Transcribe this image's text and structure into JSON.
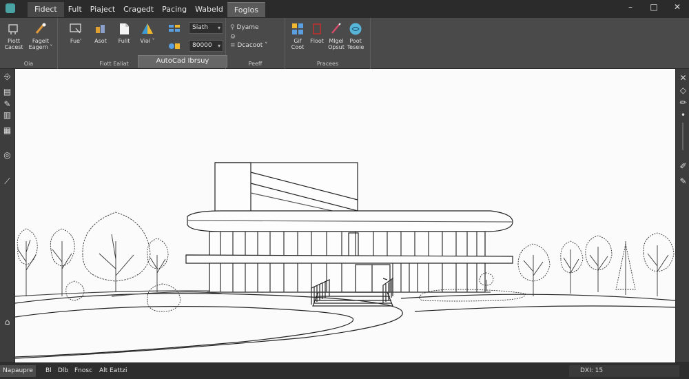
{
  "menu": {
    "tabs": [
      "Fidect",
      "Fult",
      "Piaject",
      "Cragedt",
      "Pacing",
      "Wabeld",
      "Foglos"
    ]
  },
  "window": {
    "minimize": "–",
    "maximize": "□",
    "close": "✕"
  },
  "ribbon": {
    "group1": {
      "tools": [
        "Piott\nCacest",
        "Fagelt\nEagern ˅"
      ],
      "label": "Oia"
    },
    "group2": {
      "tools": [
        "Fue'",
        "Asot",
        "Fulit",
        "Viəl ˅"
      ],
      "combo1": "Siath",
      "combo2": "80000",
      "label": "Fiott Ealiat"
    },
    "group3": {
      "items": [
        "Dyame",
        "Dcacoot ˅"
      ],
      "label": "Peeff"
    },
    "group4": {
      "tools": [
        "Gif\nCoot",
        "Floot",
        "Mlgel\nOpsut",
        "Poot\nTeseie"
      ],
      "label": "Pracees"
    },
    "library_panel": "AutoCad Ibrsuy"
  },
  "status": {
    "tabs": [
      "Napaupre",
      "Bl",
      "Dlb",
      "Fnosc",
      "Alt Eattzi"
    ],
    "coords": "DXI: 15"
  },
  "colors": {
    "chrome": "#3a3a3a",
    "canvas": "#fbfbfb",
    "accent_blue": "#59b5d8"
  },
  "icons": {
    "left_bar": [
      "layers-icon",
      "properties-icon",
      "pen-icon",
      "block-icon",
      "palette-icon",
      "compass-icon",
      "wand-icon",
      "home-icon"
    ],
    "right_bar": [
      "close-icon",
      "diamond-icon",
      "pencil-icon",
      "dot-icon",
      "scrollbar-icon",
      "edit-icon",
      "brush-icon"
    ]
  }
}
